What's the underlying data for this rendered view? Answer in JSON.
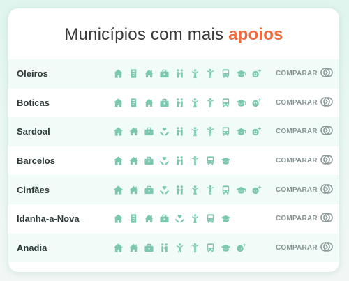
{
  "title": {
    "prefix": "Municípios com mais",
    "highlight": "apoios"
  },
  "accent_color": "#f06a3a",
  "icon_color": "#7cc7b0",
  "compare_label": "COMPARAR",
  "rows": [
    {
      "name": "Oleiros",
      "icons": [
        "house-icon",
        "document-icon",
        "home-icon",
        "briefcase-icon",
        "family-icon",
        "child-icon",
        "person-icon",
        "bus-icon",
        "graduation-cap-icon",
        "elderly-plus-icon"
      ]
    },
    {
      "name": "Boticas",
      "icons": [
        "house-icon",
        "document-icon",
        "home-icon",
        "briefcase-icon",
        "family-icon",
        "child-icon",
        "person-icon",
        "bus-icon",
        "graduation-cap-icon",
        "elderly-plus-icon"
      ]
    },
    {
      "name": "Sardoal",
      "icons": [
        "house-icon",
        "home-icon",
        "briefcase-icon",
        "hands-heart-icon",
        "family-icon",
        "child-icon",
        "person-icon",
        "bus-icon",
        "graduation-cap-icon",
        "elderly-plus-icon"
      ]
    },
    {
      "name": "Barcelos",
      "icons": [
        "house-icon",
        "home-icon",
        "briefcase-icon",
        "hands-heart-icon",
        "family-icon",
        "person-icon",
        "bus-icon",
        "graduation-cap-icon"
      ]
    },
    {
      "name": "Cinfães",
      "icons": [
        "house-icon",
        "home-icon",
        "briefcase-icon",
        "hands-heart-icon",
        "family-icon",
        "child-icon",
        "person-icon",
        "bus-icon",
        "graduation-cap-icon",
        "elderly-plus-icon"
      ]
    },
    {
      "name": "Idanha-a-Nova",
      "icons": [
        "house-icon",
        "document-icon",
        "home-icon",
        "briefcase-icon",
        "hands-heart-icon",
        "child-icon",
        "bus-icon",
        "graduation-cap-icon"
      ]
    },
    {
      "name": "Anadia",
      "icons": [
        "house-icon",
        "home-icon",
        "briefcase-icon",
        "family-icon",
        "child-icon",
        "person-icon",
        "bus-icon",
        "graduation-cap-icon",
        "elderly-plus-icon"
      ]
    }
  ]
}
